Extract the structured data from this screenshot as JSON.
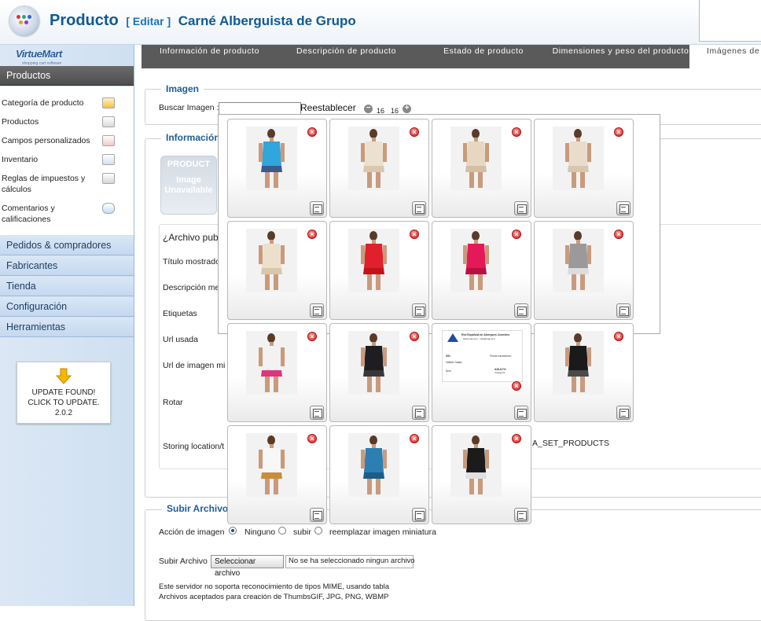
{
  "header": {
    "title": "Producto",
    "edit_label": "[ Editar ]",
    "product_name": "Carné Alberguista de Grupo"
  },
  "sidebar": {
    "logo_text": "VirtueMart",
    "logo_tagline": "shopping cart software",
    "active_menu": "Productos",
    "sub_items": [
      {
        "label": "Categoría de producto",
        "icon": "folder-icon"
      },
      {
        "label": "Productos",
        "icon": "camera-icon"
      },
      {
        "label": "Campos personalizados",
        "icon": "document-icon"
      },
      {
        "label": "Inventario",
        "icon": "chart-icon"
      },
      {
        "label": "Reglas de impuestos y cálculos",
        "icon": "calculator-icon"
      },
      {
        "label": "Comentarios y calificaciones",
        "icon": "speech-bubble-icon"
      }
    ],
    "menus": [
      "Pedidos & compradores",
      "Fabricantes",
      "Tienda",
      "Configuración",
      "Herramientas"
    ],
    "update": {
      "line1": "UPDATE FOUND!",
      "line2": "CLICK TO UPDATE.",
      "version": "2.0.2"
    }
  },
  "tabs": [
    "Información de producto",
    "Descripción de producto",
    "Estado de producto",
    "Dimensiones y peso del producto",
    "Imágenes de"
  ],
  "imagen_section": {
    "legend": "Imagen",
    "search_label": "Buscar Imagen :",
    "search_value": "",
    "reset_label": "Reestablecer",
    "page_a": "16",
    "page_b": "16"
  },
  "info_section": {
    "legend": "Información",
    "placeholder_line1": "PRODUCT",
    "placeholder_line2": "Image Unavailable",
    "fields": [
      "¿Archivo publ",
      "Título mostrado",
      "Descripción me",
      "Etiquetas",
      "Url usada",
      "Url de imagen mi",
      "Rotar",
      "Storing location/t"
    ],
    "storing_suffix": "A_SET_PRODUCTS"
  },
  "upload_section": {
    "legend": "Subir Archivo",
    "accion_label": "Acción de imagen",
    "radio_options": [
      "Ninguno",
      "subir",
      "reemplazar imagen miniatura"
    ],
    "selected_option": "Ninguno",
    "upload_label": "Subir Archivo",
    "choose_button": "Seleccionar archivo",
    "no_file": "No se ha seleccionado ningun archivo",
    "note1": "Este servidor no soporta reconocimiento de tipos MIME, usando tabla",
    "note2": "Archivos aceptados para creación de ThumbsGIF, JPG, PNG, WBMP"
  },
  "gallery": {
    "delete_symbol": "×",
    "card": {
      "title_line": "Red Española de Albergues Juveniles",
      "sub_line": "www.reaj.com · info@reaj.com",
      "number_label": "051",
      "birth_label": "Fecha nacimiento:",
      "validity_label": "Validez hasta:",
      "type_label": "ADULTO",
      "category_label": "Categoría",
      "name_label": "Nom"
    },
    "images": [
      {
        "desc": "blue polo top",
        "colors": [
          "#2fa6dc",
          "#3c5a8a"
        ]
      },
      {
        "desc": "cream strapless dress",
        "colors": [
          "#ece0cf",
          "#d9c7ae"
        ]
      },
      {
        "desc": "beige dress back",
        "colors": [
          "#e7d7c2",
          "#d3bfa4"
        ]
      },
      {
        "desc": "beige halter dress",
        "colors": [
          "#eadccb",
          "#d8c6ae"
        ]
      },
      {
        "desc": "cream dress back",
        "colors": [
          "#ece0cc",
          "#d8c7ad"
        ]
      },
      {
        "desc": "red t-shirt dress",
        "colors": [
          "#e0202a",
          "#c3121b"
        ]
      },
      {
        "desc": "pink printed dress",
        "colors": [
          "#e5185a",
          "#b8103f"
        ]
      },
      {
        "desc": "grey striped dress",
        "colors": [
          "#9a9a9a",
          "#dcdcdc"
        ]
      },
      {
        "desc": "white pink top",
        "colors": [
          "#f2f2f2",
          "#e0347a"
        ]
      },
      {
        "desc": "black hooded dress",
        "colors": [
          "#1e1e22",
          "#38383c"
        ]
      },
      {
        "desc": "alberguista card",
        "colors": [
          "#ffffff",
          "#1b4fa1"
        ]
      },
      {
        "desc": "black leather jacket",
        "colors": [
          "#1a1a1a",
          "#4a4a4a"
        ]
      },
      {
        "desc": "white heart tank top",
        "colors": [
          "#f7f7f7",
          "#c98c3a"
        ]
      },
      {
        "desc": "blue jacket",
        "colors": [
          "#2d7fb3",
          "#1b5c88"
        ]
      },
      {
        "desc": "varsity jacket",
        "colors": [
          "#1b1b1b",
          "#e0e0e0"
        ]
      }
    ]
  }
}
